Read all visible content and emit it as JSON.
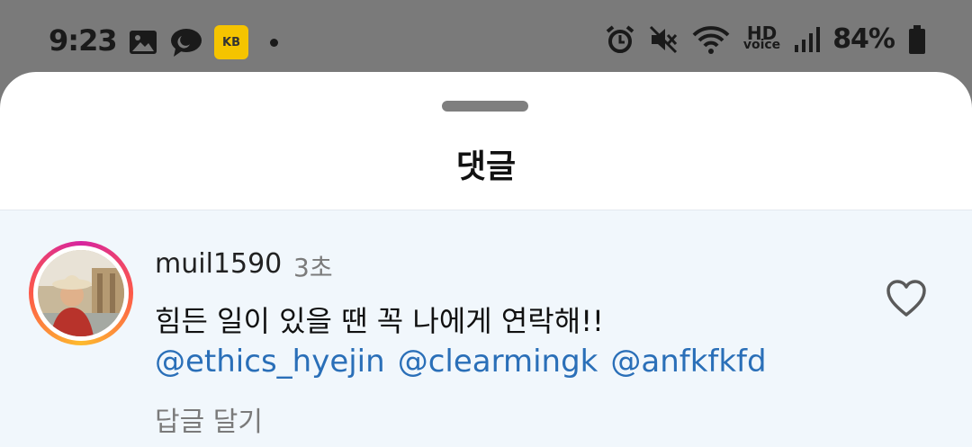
{
  "status_bar": {
    "time": "9:23",
    "carrier_badge": "KB",
    "battery": "84%",
    "hd_top": "HD",
    "hd_bottom": "voice"
  },
  "sheet": {
    "title": "댓글"
  },
  "comment": {
    "username": "muil1590",
    "time_ago": "3초",
    "text": "힘든 일이 있을 땐 꼭 나에게 연락해!!",
    "mentions": [
      "@ethics_hyejin",
      "@clearmingk",
      "@anfkfkfd"
    ],
    "reply_label": "답글 달기"
  },
  "colors": {
    "mention": "#2a6fb8",
    "comment_bg": "#f1f7fc"
  }
}
